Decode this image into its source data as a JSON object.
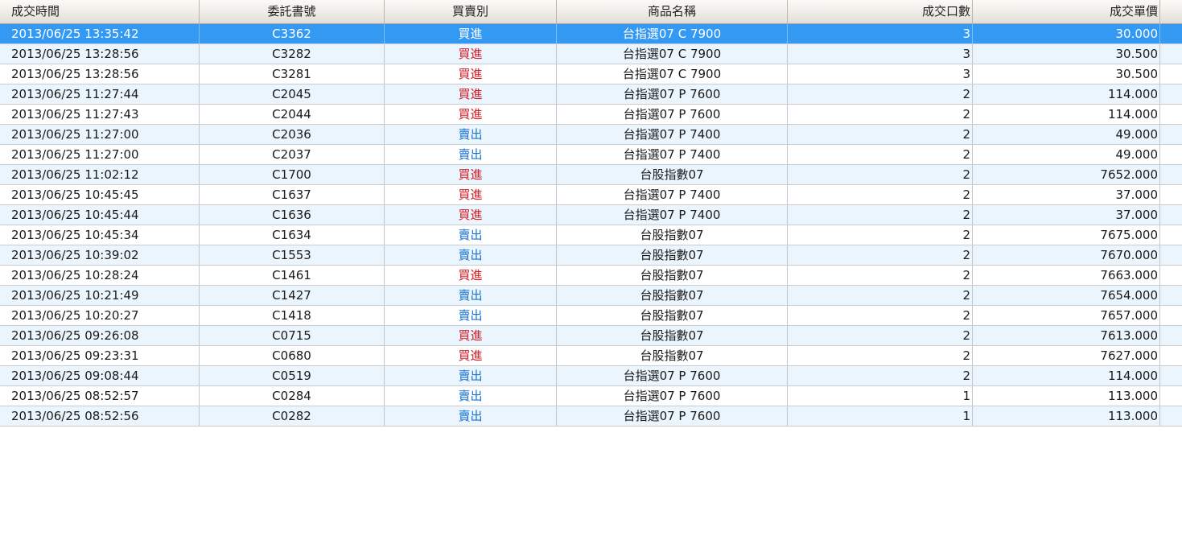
{
  "table": {
    "columns": [
      "成交時間",
      "委託書號",
      "買賣別",
      "商品名稱",
      "成交口數",
      "成交單價"
    ],
    "selected_row": 0,
    "side_colors": {
      "buy": "#d2202a",
      "sell": "#1a73d1",
      "selected": "#3399f3"
    },
    "rows": [
      {
        "time": "2013/06/25 13:35:42",
        "order": "C3362",
        "side": "買進",
        "side_type": "buy",
        "product": "台指選07 C 7900",
        "qty": "3",
        "price": "30.000"
      },
      {
        "time": "2013/06/25 13:28:56",
        "order": "C3282",
        "side": "買進",
        "side_type": "buy",
        "product": "台指選07 C 7900",
        "qty": "3",
        "price": "30.500"
      },
      {
        "time": "2013/06/25 13:28:56",
        "order": "C3281",
        "side": "買進",
        "side_type": "buy",
        "product": "台指選07 C 7900",
        "qty": "3",
        "price": "30.500"
      },
      {
        "time": "2013/06/25 11:27:44",
        "order": "C2045",
        "side": "買進",
        "side_type": "buy",
        "product": "台指選07 P 7600",
        "qty": "2",
        "price": "114.000"
      },
      {
        "time": "2013/06/25 11:27:43",
        "order": "C2044",
        "side": "買進",
        "side_type": "buy",
        "product": "台指選07 P 7600",
        "qty": "2",
        "price": "114.000"
      },
      {
        "time": "2013/06/25 11:27:00",
        "order": "C2036",
        "side": "賣出",
        "side_type": "sell",
        "product": "台指選07 P 7400",
        "qty": "2",
        "price": "49.000"
      },
      {
        "time": "2013/06/25 11:27:00",
        "order": "C2037",
        "side": "賣出",
        "side_type": "sell",
        "product": "台指選07 P 7400",
        "qty": "2",
        "price": "49.000"
      },
      {
        "time": "2013/06/25 11:02:12",
        "order": "C1700",
        "side": "買進",
        "side_type": "buy",
        "product": "台股指數07",
        "qty": "2",
        "price": "7652.000"
      },
      {
        "time": "2013/06/25 10:45:45",
        "order": "C1637",
        "side": "買進",
        "side_type": "buy",
        "product": "台指選07 P 7400",
        "qty": "2",
        "price": "37.000"
      },
      {
        "time": "2013/06/25 10:45:44",
        "order": "C1636",
        "side": "買進",
        "side_type": "buy",
        "product": "台指選07 P 7400",
        "qty": "2",
        "price": "37.000"
      },
      {
        "time": "2013/06/25 10:45:34",
        "order": "C1634",
        "side": "賣出",
        "side_type": "sell",
        "product": "台股指數07",
        "qty": "2",
        "price": "7675.000"
      },
      {
        "time": "2013/06/25 10:39:02",
        "order": "C1553",
        "side": "賣出",
        "side_type": "sell",
        "product": "台股指數07",
        "qty": "2",
        "price": "7670.000"
      },
      {
        "time": "2013/06/25 10:28:24",
        "order": "C1461",
        "side": "買進",
        "side_type": "buy",
        "product": "台股指數07",
        "qty": "2",
        "price": "7663.000"
      },
      {
        "time": "2013/06/25 10:21:49",
        "order": "C1427",
        "side": "賣出",
        "side_type": "sell",
        "product": "台股指數07",
        "qty": "2",
        "price": "7654.000"
      },
      {
        "time": "2013/06/25 10:20:27",
        "order": "C1418",
        "side": "賣出",
        "side_type": "sell",
        "product": "台股指數07",
        "qty": "2",
        "price": "7657.000"
      },
      {
        "time": "2013/06/25 09:26:08",
        "order": "C0715",
        "side": "買進",
        "side_type": "buy",
        "product": "台股指數07",
        "qty": "2",
        "price": "7613.000"
      },
      {
        "time": "2013/06/25 09:23:31",
        "order": "C0680",
        "side": "買進",
        "side_type": "buy",
        "product": "台股指數07",
        "qty": "2",
        "price": "7627.000"
      },
      {
        "time": "2013/06/25 09:08:44",
        "order": "C0519",
        "side": "賣出",
        "side_type": "sell",
        "product": "台指選07 P 7600",
        "qty": "2",
        "price": "114.000"
      },
      {
        "time": "2013/06/25 08:52:57",
        "order": "C0284",
        "side": "賣出",
        "side_type": "sell",
        "product": "台指選07 P 7600",
        "qty": "1",
        "price": "113.000"
      },
      {
        "time": "2013/06/25 08:52:56",
        "order": "C0282",
        "side": "賣出",
        "side_type": "sell",
        "product": "台指選07 P 7600",
        "qty": "1",
        "price": "113.000"
      }
    ]
  }
}
